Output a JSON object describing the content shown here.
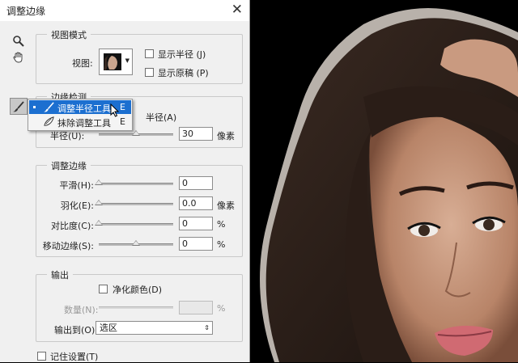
{
  "window": {
    "title": "调整边缘",
    "close_glyph": "✕"
  },
  "view_mode": {
    "legend": "视图模式",
    "view_label": "视图:",
    "show_radius": "显示半径 (J)",
    "show_original": "显示原稿 (P)"
  },
  "edge_detection": {
    "legend": "边缘检测",
    "smart_radius_partial": "半径(A)",
    "radius_label": "半径(U):",
    "radius_value": "30",
    "radius_unit": "像素",
    "radius_slider": 0.5
  },
  "flyout": {
    "items": [
      {
        "label": "调整半径工具",
        "key": "E",
        "selected": true
      },
      {
        "label": "抹除调整工具",
        "key": "E",
        "selected": false
      }
    ]
  },
  "adjust_edge": {
    "legend": "调整边缘",
    "rows": [
      {
        "label": "平滑(H):",
        "value": "0",
        "unit": "",
        "slider": 0.0
      },
      {
        "label": "羽化(E):",
        "value": "0.0",
        "unit": "像素",
        "slider": 0.0
      },
      {
        "label": "对比度(C):",
        "value": "0",
        "unit": "%",
        "slider": 0.0
      },
      {
        "label": "移动边缘(S):",
        "value": "0",
        "unit": "%",
        "slider": 0.5
      }
    ]
  },
  "output": {
    "legend": "输出",
    "decontaminate": "净化颜色(D)",
    "amount_label": "数量(N):",
    "amount_unit": "%",
    "output_to_label": "输出到(O):",
    "output_to_value": "选区"
  },
  "remember": "记住设置(T)",
  "colors": {
    "selection_blue": "#1c6fd0",
    "dialog_bg": "#f0f0f0"
  }
}
